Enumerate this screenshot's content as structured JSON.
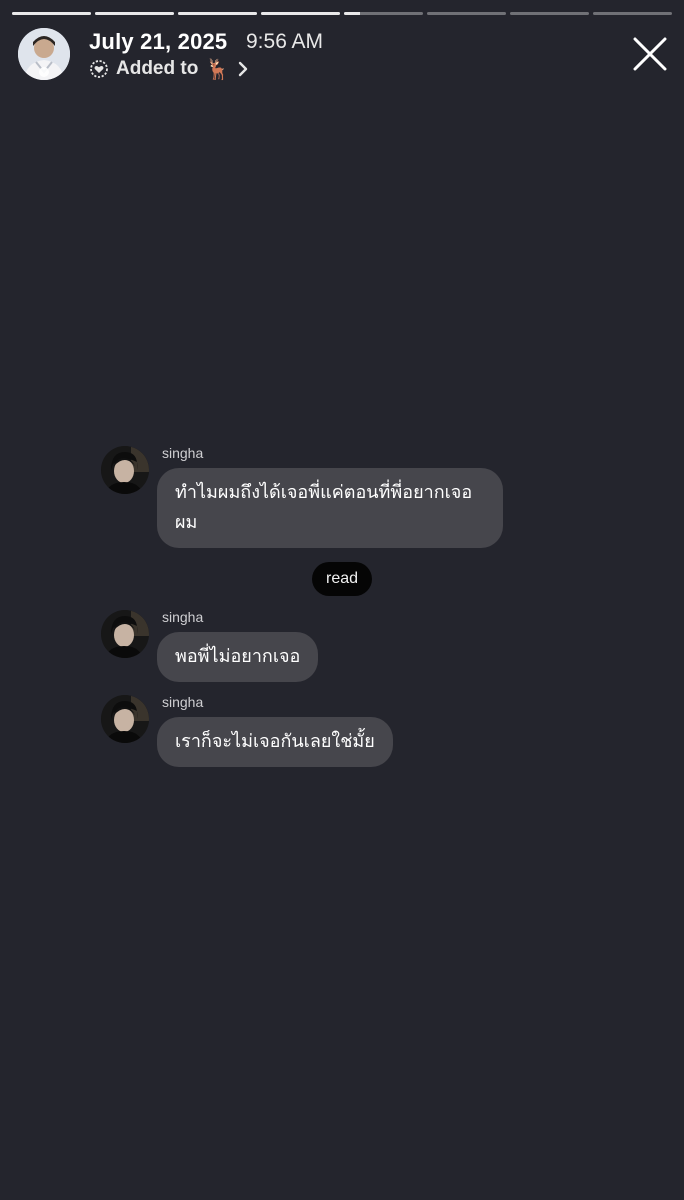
{
  "story": {
    "segments": [
      1,
      1,
      1,
      1,
      0.2,
      0,
      0,
      0
    ],
    "date": "July 21, 2025",
    "time": "9:56 AM",
    "added_to_label": "Added to",
    "added_to_emoji": "🦌",
    "icons": {
      "highlight": "heart-circle-icon",
      "chevron": "chevron-right-icon",
      "close": "close-icon"
    }
  },
  "chat": {
    "messages": [
      {
        "sender": "singha",
        "text": "ทำไมผมถึงได้เจอพี่แค่ตอนที่พี่อยากเจอ ผม"
      },
      {
        "sender": "singha",
        "text": "พอพี่ไม่อยากเจอ"
      },
      {
        "sender": "singha",
        "text": "เราก็จะไม่เจอกันเลยใช่มั้ย"
      }
    ],
    "read_label": "read"
  },
  "colors": {
    "background": "#24252d",
    "bubble": "#46464c",
    "read_pill": "#050505"
  }
}
